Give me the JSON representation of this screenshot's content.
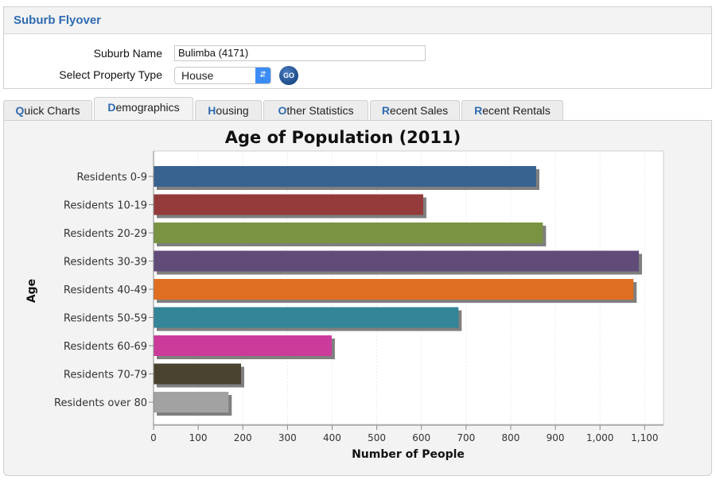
{
  "flyover": {
    "title": "Suburb Flyover",
    "suburb_label": "Suburb Name",
    "suburb_value": "Bulimba (4171)",
    "property_label": "Select Property Type",
    "property_value": "House",
    "go_label": "GO"
  },
  "tabs": [
    {
      "hot": "Q",
      "rest": "uick Charts",
      "active": false
    },
    {
      "hot": "D",
      "rest": "emographics",
      "active": true
    },
    {
      "hot": "H",
      "rest": "ousing",
      "active": false
    },
    {
      "hot": "O",
      "rest": "ther Statistics",
      "active": false
    },
    {
      "hot": "R",
      "rest": "ecent Sales",
      "active": false
    },
    {
      "hot": "R",
      "rest": "ecent Rentals",
      "active": false
    }
  ],
  "chart_data": {
    "type": "bar",
    "orientation": "horizontal",
    "title": "Age of Population (2011)",
    "xlabel": "Number of People",
    "ylabel": "Age",
    "categories": [
      "Residents 0-9",
      "Residents 10-19",
      "Residents 20-29",
      "Residents 30-39",
      "Residents 40-49",
      "Residents 50-59",
      "Residents 60-69",
      "Residents 70-79",
      "Residents over 80"
    ],
    "values": [
      857,
      604,
      872,
      1087,
      1075,
      683,
      399,
      196,
      168
    ],
    "colors": [
      "#386290",
      "#943a3a",
      "#799343",
      "#614b79",
      "#e06e22",
      "#338598",
      "#cc3b9a",
      "#4a4330",
      "#a2a2a2"
    ],
    "xlim": [
      0,
      1130
    ],
    "xticks": [
      0,
      100,
      200,
      300,
      400,
      500,
      600,
      700,
      800,
      900,
      1000,
      1100
    ],
    "xtick_labels": [
      "0",
      "100",
      "200",
      "300",
      "400",
      "500",
      "600",
      "700",
      "800",
      "900",
      "1,000",
      "1,100"
    ],
    "grid": true,
    "legend": "none"
  }
}
